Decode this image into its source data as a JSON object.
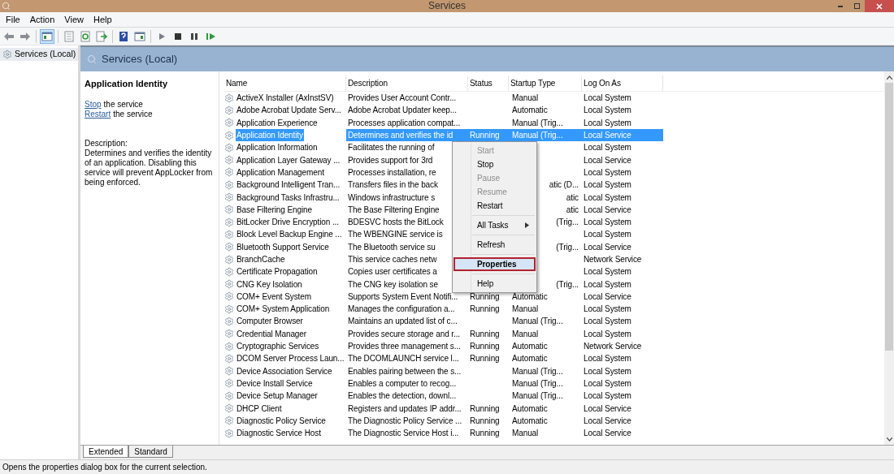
{
  "window": {
    "title": "Services"
  },
  "menu_bar": [
    "File",
    "Action",
    "View",
    "Help"
  ],
  "toolbar": [
    {
      "kind": "back",
      "selected": false
    },
    {
      "kind": "forward",
      "selected": false
    },
    {
      "kind": "sep"
    },
    {
      "kind": "tree",
      "selected": true
    },
    {
      "kind": "sep"
    },
    {
      "kind": "export",
      "selected": false
    },
    {
      "kind": "refresh",
      "selected": false
    },
    {
      "kind": "list",
      "selected": false
    },
    {
      "kind": "sep"
    },
    {
      "kind": "help",
      "selected": false
    },
    {
      "kind": "view",
      "selected": false
    },
    {
      "kind": "sep"
    },
    {
      "kind": "play",
      "selected": false
    },
    {
      "kind": "stop",
      "selected": false
    },
    {
      "kind": "pause",
      "selected": false
    },
    {
      "kind": "resume",
      "selected": false
    }
  ],
  "tree": [
    {
      "label": "Services (Local)",
      "selected": true
    }
  ],
  "pane_title": "Services (Local)",
  "details": {
    "title": "Application Identity",
    "actions": [
      {
        "link": "Stop",
        "text": "the service"
      },
      {
        "link": "Restart",
        "text": "the service"
      }
    ],
    "description_label": "Description:",
    "description": "Determines and verifies the identity of an application. Disabling this service will prevent AppLocker from being enforced."
  },
  "table": {
    "columns": [
      "Name",
      "Description",
      "Status",
      "Startup Type",
      "Log On As"
    ],
    "rows": [
      {
        "name": "ActiveX Installer (AxInstSV)",
        "description": "Provides User Account Contr...",
        "status": "",
        "startup_type": "Manual",
        "log_on_as": "Local System",
        "selected": false,
        "covered": false
      },
      {
        "name": "Adobe Acrobat Update Serv...",
        "description": "Adobe Acrobat Updater keep...",
        "status": "",
        "startup_type": "Automatic",
        "log_on_as": "Local System",
        "selected": false,
        "covered": false
      },
      {
        "name": "Application Experience",
        "description": "Processes application compat...",
        "status": "",
        "startup_type": "Manual (Trig...",
        "log_on_as": "Local System",
        "selected": false,
        "covered": false
      },
      {
        "name": "Application Identity",
        "description": "Determines and verifies the id",
        "status": "Running",
        "startup_type": "Manual (Trig...",
        "log_on_as": "Local Service",
        "selected": true,
        "covered": false
      },
      {
        "name": "Application Information",
        "description": "Facilitates the running of",
        "status": "",
        "startup_type": "",
        "log_on_as": "Local System",
        "selected": false,
        "covered": true
      },
      {
        "name": "Application Layer Gateway ...",
        "description": "Provides support for 3rd",
        "status": "",
        "startup_type": "",
        "log_on_as": "Local Service",
        "selected": false,
        "covered": true
      },
      {
        "name": "Application Management",
        "description": "Processes installation, re",
        "status": "",
        "startup_type": "",
        "log_on_as": "Local System",
        "selected": false,
        "covered": true
      },
      {
        "name": "Background Intelligent Tran...",
        "description": "Transfers files in the back",
        "status": "",
        "startup_type": "atic (D...",
        "log_on_as": "Local System",
        "selected": false,
        "covered": true
      },
      {
        "name": "Background Tasks Infrastru...",
        "description": "Windows infrastructure s",
        "status": "",
        "startup_type": "atic",
        "log_on_as": "Local System",
        "selected": false,
        "covered": true
      },
      {
        "name": "Base Filtering Engine",
        "description": "The Base Filtering Engine",
        "status": "",
        "startup_type": "atic",
        "log_on_as": "Local Service",
        "selected": false,
        "covered": true
      },
      {
        "name": "BitLocker Drive Encryption ...",
        "description": "BDESVC hosts the BitLock",
        "status": "",
        "startup_type": "(Trig...",
        "log_on_as": "Local System",
        "selected": false,
        "covered": true
      },
      {
        "name": "Block Level Backup Engine ...",
        "description": "The WBENGINE service is",
        "status": "",
        "startup_type": "",
        "log_on_as": "Local System",
        "selected": false,
        "covered": true
      },
      {
        "name": "Bluetooth Support Service",
        "description": "The Bluetooth service su",
        "status": "",
        "startup_type": "(Trig...",
        "log_on_as": "Local Service",
        "selected": false,
        "covered": true
      },
      {
        "name": "BranchCache",
        "description": "This service caches netw",
        "status": "",
        "startup_type": "",
        "log_on_as": "Network Service",
        "selected": false,
        "covered": true
      },
      {
        "name": "Certificate Propagation",
        "description": "Copies user certificates a",
        "status": "",
        "startup_type": "",
        "log_on_as": "Local System",
        "selected": false,
        "covered": true
      },
      {
        "name": "CNG Key Isolation",
        "description": "The CNG key isolation se",
        "status": "",
        "startup_type": "(Trig...",
        "log_on_as": "Local System",
        "selected": false,
        "covered": true
      },
      {
        "name": "COM+ Event System",
        "description": "Supports System Event Notifi...",
        "status": "Running",
        "startup_type": "Automatic",
        "log_on_as": "Local Service",
        "selected": false,
        "covered": false
      },
      {
        "name": "COM+ System Application",
        "description": "Manages the configuration a...",
        "status": "Running",
        "startup_type": "Manual",
        "log_on_as": "Local System",
        "selected": false,
        "covered": false
      },
      {
        "name": "Computer Browser",
        "description": "Maintains an updated list of c...",
        "status": "",
        "startup_type": "Manual (Trig...",
        "log_on_as": "Local System",
        "selected": false,
        "covered": false
      },
      {
        "name": "Credential Manager",
        "description": "Provides secure storage and r...",
        "status": "Running",
        "startup_type": "Manual",
        "log_on_as": "Local System",
        "selected": false,
        "covered": false
      },
      {
        "name": "Cryptographic Services",
        "description": "Provides three management s...",
        "status": "Running",
        "startup_type": "Automatic",
        "log_on_as": "Network Service",
        "selected": false,
        "covered": false
      },
      {
        "name": "DCOM Server Process Laun...",
        "description": "The DCOMLAUNCH service l...",
        "status": "Running",
        "startup_type": "Automatic",
        "log_on_as": "Local System",
        "selected": false,
        "covered": false
      },
      {
        "name": "Device Association Service",
        "description": "Enables pairing between the s...",
        "status": "",
        "startup_type": "Manual (Trig...",
        "log_on_as": "Local System",
        "selected": false,
        "covered": false
      },
      {
        "name": "Device Install Service",
        "description": "Enables a computer to recog...",
        "status": "",
        "startup_type": "Manual (Trig...",
        "log_on_as": "Local System",
        "selected": false,
        "covered": false
      },
      {
        "name": "Device Setup Manager",
        "description": "Enables the detection, downl...",
        "status": "",
        "startup_type": "Manual (Trig...",
        "log_on_as": "Local System",
        "selected": false,
        "covered": false
      },
      {
        "name": "DHCP Client",
        "description": "Registers and updates IP addr...",
        "status": "Running",
        "startup_type": "Automatic",
        "log_on_as": "Local Service",
        "selected": false,
        "covered": false
      },
      {
        "name": "Diagnostic Policy Service",
        "description": "The Diagnostic Policy Service ...",
        "status": "Running",
        "startup_type": "Automatic",
        "log_on_as": "Local Service",
        "selected": false,
        "covered": false
      },
      {
        "name": "Diagnostic Service Host",
        "description": "The Diagnostic Service Host i...",
        "status": "Running",
        "startup_type": "Manual",
        "log_on_as": "Local Service",
        "selected": false,
        "covered": false
      }
    ]
  },
  "context_menu": [
    {
      "kind": "item",
      "label": "Start",
      "disabled": true,
      "selected": false,
      "default": false
    },
    {
      "kind": "item",
      "label": "Stop",
      "disabled": false,
      "selected": false,
      "default": false
    },
    {
      "kind": "item",
      "label": "Pause",
      "disabled": true,
      "selected": false,
      "default": false
    },
    {
      "kind": "item",
      "label": "Resume",
      "disabled": true,
      "selected": false,
      "default": false
    },
    {
      "kind": "item",
      "label": "Restart",
      "disabled": false,
      "selected": false,
      "default": false
    },
    {
      "kind": "separator"
    },
    {
      "kind": "submenu",
      "label": "All Tasks",
      "disabled": false,
      "selected": false,
      "default": false
    },
    {
      "kind": "separator"
    },
    {
      "kind": "item",
      "label": "Refresh",
      "disabled": false,
      "selected": false,
      "default": false
    },
    {
      "kind": "separator"
    },
    {
      "kind": "item",
      "label": "Properties",
      "disabled": false,
      "selected": true,
      "default": true
    },
    {
      "kind": "separator"
    },
    {
      "kind": "item",
      "label": "Help",
      "disabled": false,
      "selected": false,
      "default": false
    }
  ],
  "view_tabs": [
    {
      "label": "Extended",
      "selected": true
    },
    {
      "label": "Standard",
      "selected": false
    }
  ],
  "status_bar": "Opens the properties dialog box for the current selection."
}
